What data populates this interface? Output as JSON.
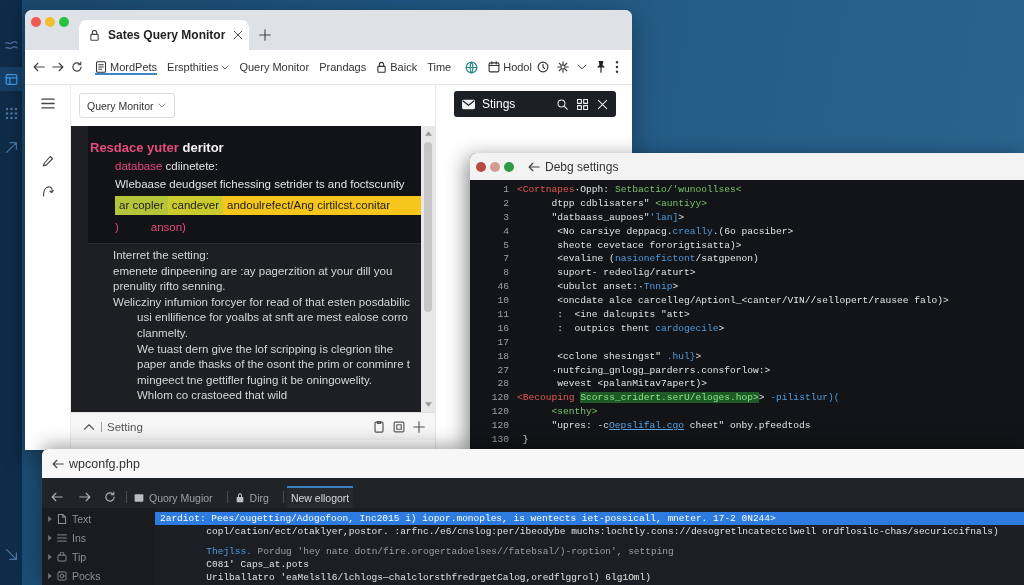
{
  "dock": [
    {
      "selected": false
    },
    {
      "selected": true
    },
    {
      "selected": false
    },
    {
      "selected": false
    },
    {
      "selected": false
    }
  ],
  "browser": {
    "tab": {
      "title": "Sates Query Monitor"
    },
    "toolbar": [
      {
        "kind": "site",
        "label": "MordPets",
        "selected": true
      },
      {
        "kind": "menu",
        "label": "Erspthities",
        "selected": false
      },
      {
        "kind": "plain",
        "label": "Query Monitor",
        "selected": false
      },
      {
        "kind": "plain",
        "label": "Prandags",
        "selected": false
      },
      {
        "kind": "lock",
        "label": "Baick",
        "selected": false
      },
      {
        "kind": "plain",
        "label": "Time",
        "selected": false
      },
      {
        "kind": "extension",
        "selected": false
      },
      {
        "kind": "calendar",
        "label": "Hodol",
        "selected": false
      }
    ],
    "select": {
      "value": "Query Monitor"
    },
    "side_panel": {
      "title": "Stings"
    }
  },
  "editor": {
    "code": [
      {
        "kind": "heading",
        "segments": [
          {
            "text": "Resdace yuter",
            "kind": "keyword"
          },
          {
            "text": " deritor",
            "kind": "strong"
          }
        ]
      },
      {
        "kind": "line",
        "segments": [
          {
            "text": "database",
            "kind": "keyword"
          },
          {
            "text": " cdiinetete:",
            "kind": "plain"
          }
        ]
      },
      {
        "kind": "line",
        "segments": [
          {
            "text": "Wlebaase deudgset fichessing setrider ts and foctscunity",
            "kind": "plain"
          }
        ]
      },
      {
        "kind": "highlight",
        "segments": [
          {
            "text": "ar copler",
            "kind": "mark",
            "color": "#b4c53c"
          },
          {
            "text": "candever",
            "kind": "mark",
            "color": "#cccb2e"
          },
          {
            "text": "andoulrefect/Ang cirtilcst.conitar",
            "kind": "mark",
            "color": "#f6c61c"
          }
        ]
      },
      {
        "kind": "line",
        "segments": [
          {
            "text": ")          anson)",
            "kind": "keyword"
          }
        ]
      }
    ],
    "paragraphs": [
      {
        "kind": "lead",
        "text": "Interret the setting:"
      },
      {
        "kind": "lead",
        "text": "emenete dinpeening are :ay pagerzition at your dill you prenulity rifto senning."
      },
      {
        "kind": "first",
        "text": "Welicziny infumion forcyer for read of that esten posdabilic"
      },
      {
        "kind": "cont",
        "text": "usi enllifience for yoalbs at snft are mest ealose corro"
      },
      {
        "kind": "cont",
        "text": "clanmelty."
      },
      {
        "kind": "cont",
        "text": "We tuast dern give the lof scripping is clegrion tihe"
      },
      {
        "kind": "cont",
        "text": "paper ande thasks of the osont the prim or conminre t"
      },
      {
        "kind": "cont",
        "text": "mingeect tne gettifler fuging it be oningowelity."
      },
      {
        "kind": "cont",
        "text": "Whlom co crastoeed that wild"
      }
    ],
    "footer": {
      "label": "Setting"
    }
  },
  "code_window": {
    "title": "Debg settings",
    "lines": [
      {
        "number": "1",
        "segments": [
          {
            "text": "<Cortnapes",
            "kind": "tag"
          },
          {
            "text": "·Opph: ",
            "kind": "plain"
          },
          {
            "text": "Setbactio/'wunoollses<",
            "kind": "string"
          }
        ]
      },
      {
        "number": "2",
        "segments": [
          {
            "text": "      dtpp cdblisaters\" ",
            "kind": "plain"
          },
          {
            "text": "<auntiyy>",
            "kind": "string"
          }
        ]
      },
      {
        "number": "3",
        "segments": [
          {
            "text": "      \"datbaass_aupoes\"",
            "kind": "plain"
          },
          {
            "text": "'lan]",
            "kind": "attr"
          },
          {
            "text": ">",
            "kind": "plain"
          }
        ]
      },
      {
        "number": "4",
        "segments": [
          {
            "text": "       <No carsiye deppacg.",
            "kind": "plain"
          },
          {
            "text": "creally",
            "kind": "attr"
          },
          {
            "text": ".(6o pacsiber>",
            "kind": "plain"
          }
        ]
      },
      {
        "number": "5",
        "segments": [
          {
            "text": "       sheote cevetace fororigtisatta)>",
            "kind": "plain"
          }
        ]
      },
      {
        "number": "7",
        "segments": [
          {
            "text": "       <evaline (",
            "kind": "plain"
          },
          {
            "text": "nasionefictont",
            "kind": "attr"
          },
          {
            "text": "/satgpenon)",
            "kind": "plain"
          }
        ]
      },
      {
        "number": "8",
        "segments": [
          {
            "text": "       suport- redeolig/raturt>",
            "kind": "plain"
          }
        ]
      },
      {
        "number": "46",
        "segments": [
          {
            "text": "       <ubulct anset:·",
            "kind": "plain"
          },
          {
            "text": "Tnnip",
            "kind": "attr"
          },
          {
            "text": ">",
            "kind": "plain"
          }
        ]
      },
      {
        "number": "10",
        "segments": [
          {
            "text": "       <oncdate alce carcelleg/Aptionl_<canter/VIN//sellopert/rausee falo)>",
            "kind": "plain"
          }
        ]
      },
      {
        "number": "11",
        "segments": [
          {
            "text": "       :  <ine dalcupits \"att>",
            "kind": "plain"
          }
        ]
      },
      {
        "number": "16",
        "segments": [
          {
            "text": "       :  outpics thent ",
            "kind": "plain"
          },
          {
            "text": "cardogecile",
            "kind": "attr"
          },
          {
            "text": ">",
            "kind": "plain"
          }
        ]
      },
      {
        "number": "17"
      },
      {
        "number": "18",
        "segments": [
          {
            "text": "       <cclone shesingst\" ",
            "kind": "plain"
          },
          {
            "text": ".hul}",
            "kind": "attr"
          },
          {
            "text": ">",
            "kind": "plain"
          }
        ]
      },
      {
        "number": "27",
        "segments": [
          {
            "text": "      ·nutfcing_gnlogg_parderrs.consforlow:>",
            "kind": "plain"
          }
        ]
      },
      {
        "number": "28",
        "segments": [
          {
            "text": "       wevest <palanMitav7apert)>",
            "kind": "plain"
          }
        ]
      },
      {
        "number": "120",
        "segments": [
          {
            "text": "<Becouping ",
            "kind": "tag"
          },
          {
            "text": "Scorss_cridert.serU/eloges.hop>",
            "kind": "mark"
          },
          {
            "text": "> ",
            "kind": "plain"
          },
          {
            "text": "-pilistlur)(",
            "kind": "attr"
          }
        ]
      },
      {
        "number": "120",
        "segments": [
          {
            "text": "      <senthy>",
            "kind": "string"
          }
        ]
      },
      {
        "number": "120",
        "segments": [
          {
            "text": "      \"upres: -c",
            "kind": "plain"
          },
          {
            "text": "Oepslifal.cgo",
            "kind": "link"
          },
          {
            "text": " cheet\" onby.pfeedtods",
            "kind": "plain"
          }
        ]
      },
      {
        "number": "130",
        "segments": [
          {
            "text": " }",
            "kind": "plain"
          }
        ]
      }
    ]
  },
  "bottom_window": {
    "title": "wpconfg.php",
    "tabs": [
      {
        "kind": "page",
        "label": "Quory Mugior",
        "selected": false
      },
      {
        "kind": "lock",
        "label": "Dirg",
        "selected": false
      },
      {
        "kind": "plain",
        "label": "New ellogort",
        "selected": true
      }
    ],
    "tree": [
      {
        "label": "Text",
        "expanded": false
      },
      {
        "label": "Ins",
        "expanded": false
      },
      {
        "label": "Tip",
        "expanded": false
      },
      {
        "label": "Pocks",
        "expanded": false
      }
    ],
    "rows": [
      {
        "selected": true,
        "segments": [
          {
            "text": "2ardiot:",
            "kind": "label"
          },
          {
            "text": " Pees/ougetting/Adogofoon, Inc2015 i) iopor.monoples, is wentects iet-possicall, mneter. 17-2 0N244>",
            "kind": "plain"
          }
        ]
      },
      {
        "selected": false,
        "segments": [
          {
            "text": "         copl/cation/ect/otaklyer,postor. :arfnc./e6/cnslog:per/ibeodybe muchs:lochtly.cons://desogretlncatectclwell ordflosilc-chas/securiccifnals)",
            "kind": "plain"
          }
        ]
      },
      {
        "selected": false,
        "segments": [
          {
            "text": "         Thejlss.",
            "kind": "attr"
          },
          {
            "text": " Pordug 'hey nate dotn/fire.orogertadoelses//fatebsal/)-roption', settping",
            "kind": "dim"
          }
        ]
      },
      {
        "selected": false,
        "segments": [
          {
            "text": "         C081' Caps_at.pots",
            "kind": "plain"
          }
        ]
      },
      {
        "selected": false,
        "segments": [
          {
            "text": "         Urilballatro 'eaMelsll6/lchlogs—chalclorsthfredrgetCalog,oredflggrol) 6lg1Oml)",
            "kind": "plain"
          }
        ]
      }
    ]
  }
}
